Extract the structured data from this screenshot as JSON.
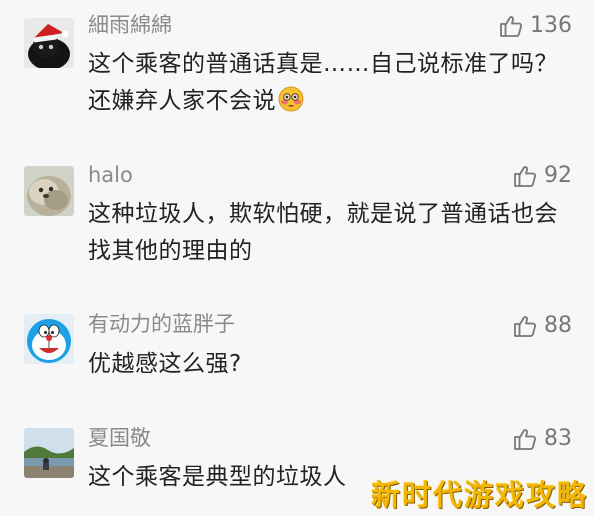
{
  "comments": [
    {
      "username": "細雨綿綿",
      "text": "这个乘客的普通话真是……自己说标准了吗？还嫌弃人家不会说",
      "likes": "136",
      "avatar": "black-cat-santa-hat-avatar",
      "emoji": "flushed-face-emoji"
    },
    {
      "username": "halo",
      "text": "这种垃圾人，欺软怕硬，就是说了普通话也会找其他的理由的",
      "likes": "92",
      "avatar": "fluffy-animal-avatar"
    },
    {
      "username": "有动力的蓝胖子",
      "text": "优越感这么强?",
      "likes": "88",
      "avatar": "doraemon-avatar"
    },
    {
      "username": "夏国敬",
      "text": "这个乘客是典型的垃圾人",
      "likes": "83",
      "avatar": "landscape-photo-avatar"
    }
  ],
  "watermark": "新时代游戏攻略",
  "colors": {
    "username": "#8a8a8a",
    "text": "#222222",
    "like": "#777777",
    "watermark": "#f2b705"
  }
}
